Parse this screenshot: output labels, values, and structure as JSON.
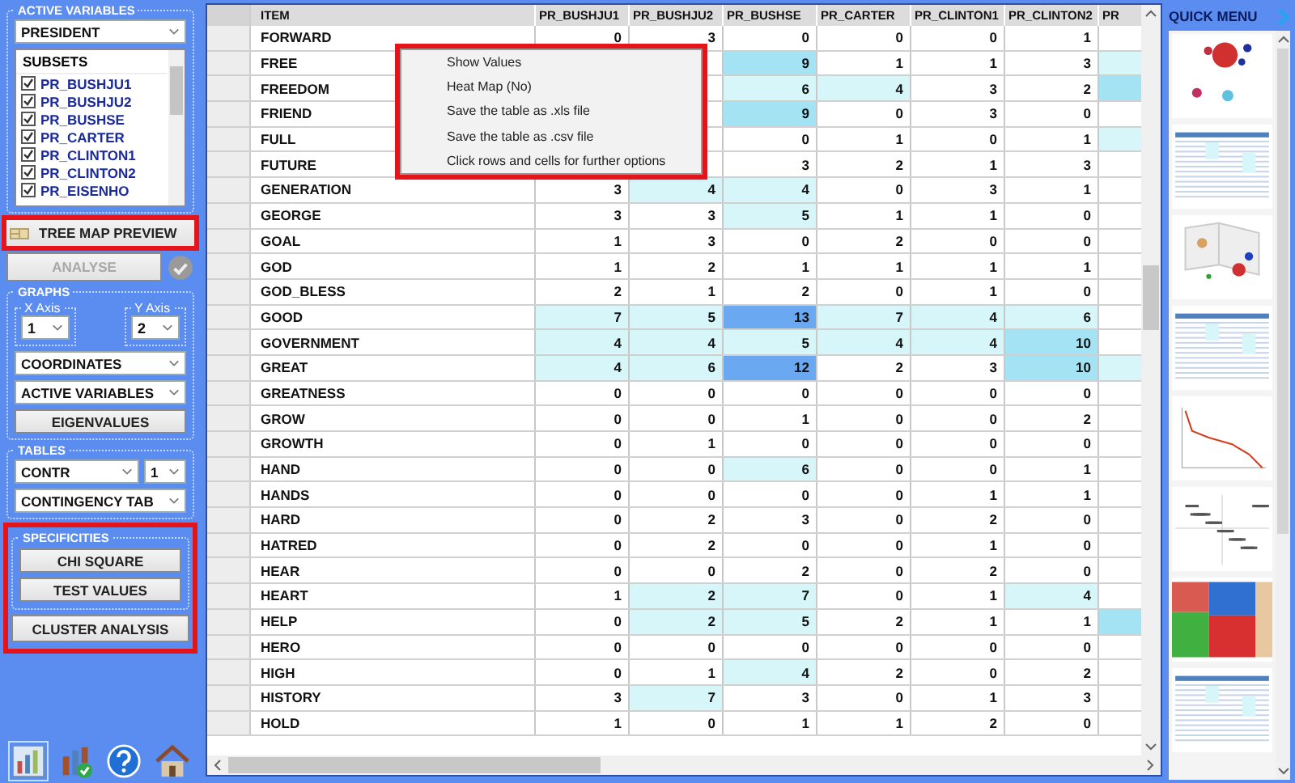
{
  "left_panel": {
    "active_variables": {
      "title": "ACTIVE VARIABLES",
      "dropdown": "PRESIDENT",
      "subsets_title": "SUBSETS",
      "subsets": [
        {
          "label": "PR_BUSHJU1",
          "checked": true
        },
        {
          "label": "PR_BUSHJU2",
          "checked": true
        },
        {
          "label": "PR_BUSHSE",
          "checked": true
        },
        {
          "label": "PR_CARTER",
          "checked": true
        },
        {
          "label": "PR_CLINTON1",
          "checked": true
        },
        {
          "label": "PR_CLINTON2",
          "checked": true
        },
        {
          "label": "PR_EISENHO",
          "checked": true
        }
      ]
    },
    "tree_map_button": {
      "label": "TREE MAP PREVIEW",
      "highlighted": true
    },
    "analyse_button": {
      "label": "ANALYSE",
      "disabled": true
    },
    "graphs": {
      "title": "GRAPHS",
      "x_axis": {
        "label": "X Axis",
        "value": "1"
      },
      "y_axis": {
        "label": "Y Axis",
        "value": "2"
      },
      "dropdowns": [
        "COORDINATES",
        "ACTIVE VARIABLES"
      ],
      "button": "EIGENVALUES"
    },
    "tables": {
      "title": "TABLES",
      "measure": "CONTR",
      "number": "1",
      "table_type": "CONTINGENCY TAB"
    },
    "specificities": {
      "title": "SPECIFICITIES",
      "highlighted": true,
      "buttons": [
        "CHI SQUARE",
        "TEST VALUES"
      ],
      "cluster_button": "CLUSTER ANALYSIS"
    }
  },
  "table": {
    "columns": [
      "ITEM",
      "PR_BUSHJU1",
      "PR_BUSHJU2",
      "PR_BUSHSE",
      "PR_CARTER",
      "PR_CLINTON1",
      "PR_CLINTON2",
      "PR"
    ],
    "rows": [
      {
        "cells": [
          {
            "value": "FORWARD"
          },
          {
            "value": "0"
          },
          {
            "value": "3"
          },
          {
            "value": "0"
          },
          {
            "value": "0"
          },
          {
            "value": "0"
          },
          {
            "value": "1"
          },
          {}
        ]
      },
      {
        "cells": [
          {
            "value": "FREE"
          },
          {},
          {},
          {
            "value": "9",
            "color": "#a3e3f3"
          },
          {
            "value": "1"
          },
          {
            "value": "1"
          },
          {
            "value": "3"
          },
          {
            "color": "#d6f6f9"
          }
        ]
      },
      {
        "cells": [
          {
            "value": "FREEDOM"
          },
          {},
          {},
          {
            "value": "6",
            "color": "#d6f6f9"
          },
          {
            "value": "4",
            "color": "#d6f6f9"
          },
          {
            "value": "3"
          },
          {
            "value": "2"
          },
          {
            "color": "#a3e3f3"
          }
        ]
      },
      {
        "cells": [
          {
            "value": "FRIEND"
          },
          {},
          {},
          {
            "value": "9",
            "color": "#a3e3f3"
          },
          {
            "value": "0"
          },
          {
            "value": "3"
          },
          {
            "value": "0"
          },
          {}
        ]
      },
      {
        "cells": [
          {
            "value": "FULL"
          },
          {},
          {},
          {
            "value": "0"
          },
          {
            "value": "1"
          },
          {
            "value": "0"
          },
          {
            "value": "1"
          },
          {
            "color": "#d6f6f9"
          }
        ]
      },
      {
        "cells": [
          {
            "value": "FUTURE"
          },
          {},
          {},
          {
            "value": "3"
          },
          {
            "value": "2"
          },
          {
            "value": "1"
          },
          {
            "value": "3"
          },
          {}
        ]
      },
      {
        "cells": [
          {
            "value": "GENERATION"
          },
          {
            "value": "3"
          },
          {
            "value": "4",
            "color": "#d6f6f9"
          },
          {
            "value": "4",
            "color": "#d6f6f9"
          },
          {
            "value": "0"
          },
          {
            "value": "3"
          },
          {
            "value": "1"
          },
          {}
        ]
      },
      {
        "cells": [
          {
            "value": "GEORGE"
          },
          {
            "value": "3"
          },
          {
            "value": "3"
          },
          {
            "value": "5",
            "color": "#d6f6f9"
          },
          {
            "value": "1"
          },
          {
            "value": "1"
          },
          {
            "value": "0"
          },
          {}
        ]
      },
      {
        "cells": [
          {
            "value": "GOAL"
          },
          {
            "value": "1"
          },
          {
            "value": "3"
          },
          {
            "value": "0"
          },
          {
            "value": "2"
          },
          {
            "value": "0"
          },
          {
            "value": "0"
          },
          {}
        ]
      },
      {
        "cells": [
          {
            "value": "GOD"
          },
          {
            "value": "1"
          },
          {
            "value": "2"
          },
          {
            "value": "1"
          },
          {
            "value": "1"
          },
          {
            "value": "1"
          },
          {
            "value": "1"
          },
          {}
        ]
      },
      {
        "cells": [
          {
            "value": "GOD_BLESS"
          },
          {
            "value": "2"
          },
          {
            "value": "1"
          },
          {
            "value": "2"
          },
          {
            "value": "0"
          },
          {
            "value": "1"
          },
          {
            "value": "0"
          },
          {}
        ]
      },
      {
        "cells": [
          {
            "value": "GOOD"
          },
          {
            "value": "7",
            "color": "#d6f6f9"
          },
          {
            "value": "5",
            "color": "#d6f6f9"
          },
          {
            "value": "13",
            "color": "#6aa8f2"
          },
          {
            "value": "7",
            "color": "#d6f6f9"
          },
          {
            "value": "4",
            "color": "#d6f6f9"
          },
          {
            "value": "6",
            "color": "#d6f6f9"
          },
          {}
        ]
      },
      {
        "cells": [
          {
            "value": "GOVERNMENT"
          },
          {
            "value": "4",
            "color": "#d6f6f9"
          },
          {
            "value": "4",
            "color": "#d6f6f9"
          },
          {
            "value": "5",
            "color": "#d6f6f9"
          },
          {
            "value": "4",
            "color": "#d6f6f9"
          },
          {
            "value": "4",
            "color": "#d6f6f9"
          },
          {
            "value": "10",
            "color": "#a3e3f3"
          },
          {}
        ]
      },
      {
        "cells": [
          {
            "value": "GREAT"
          },
          {
            "value": "4",
            "color": "#d6f6f9"
          },
          {
            "value": "6",
            "color": "#d6f6f9"
          },
          {
            "value": "12",
            "color": "#6aa8f2"
          },
          {
            "value": "2"
          },
          {
            "value": "3"
          },
          {
            "value": "10",
            "color": "#a3e3f3"
          },
          {
            "color": "#d6f6f9"
          }
        ]
      },
      {
        "cells": [
          {
            "value": "GREATNESS"
          },
          {
            "value": "0"
          },
          {
            "value": "0"
          },
          {
            "value": "0"
          },
          {
            "value": "0"
          },
          {
            "value": "0"
          },
          {
            "value": "0"
          },
          {}
        ]
      },
      {
        "cells": [
          {
            "value": "GROW"
          },
          {
            "value": "0"
          },
          {
            "value": "0"
          },
          {
            "value": "1"
          },
          {
            "value": "0"
          },
          {
            "value": "0"
          },
          {
            "value": "2"
          },
          {}
        ]
      },
      {
        "cells": [
          {
            "value": "GROWTH"
          },
          {
            "value": "0"
          },
          {
            "value": "1"
          },
          {
            "value": "0"
          },
          {
            "value": "0"
          },
          {
            "value": "0"
          },
          {
            "value": "0"
          },
          {}
        ]
      },
      {
        "cells": [
          {
            "value": "HAND"
          },
          {
            "value": "0"
          },
          {
            "value": "0"
          },
          {
            "value": "6",
            "color": "#d6f6f9"
          },
          {
            "value": "0"
          },
          {
            "value": "0"
          },
          {
            "value": "1"
          },
          {}
        ]
      },
      {
        "cells": [
          {
            "value": "HANDS"
          },
          {
            "value": "0"
          },
          {
            "value": "0"
          },
          {
            "value": "0"
          },
          {
            "value": "0"
          },
          {
            "value": "1"
          },
          {
            "value": "1"
          },
          {}
        ]
      },
      {
        "cells": [
          {
            "value": "HARD"
          },
          {
            "value": "0"
          },
          {
            "value": "2"
          },
          {
            "value": "3"
          },
          {
            "value": "0"
          },
          {
            "value": "2"
          },
          {
            "value": "0"
          },
          {}
        ]
      },
      {
        "cells": [
          {
            "value": "HATRED"
          },
          {
            "value": "0"
          },
          {
            "value": "2"
          },
          {
            "value": "0"
          },
          {
            "value": "0"
          },
          {
            "value": "1"
          },
          {
            "value": "0"
          },
          {}
        ]
      },
      {
        "cells": [
          {
            "value": "HEAR"
          },
          {
            "value": "0"
          },
          {
            "value": "0"
          },
          {
            "value": "2"
          },
          {
            "value": "0"
          },
          {
            "value": "2"
          },
          {
            "value": "0"
          },
          {}
        ]
      },
      {
        "cells": [
          {
            "value": "HEART"
          },
          {
            "value": "1"
          },
          {
            "value": "2",
            "color": "#d6f6f9"
          },
          {
            "value": "7",
            "color": "#d6f6f9"
          },
          {
            "value": "0"
          },
          {
            "value": "1"
          },
          {
            "value": "4",
            "color": "#d6f6f9"
          },
          {}
        ]
      },
      {
        "cells": [
          {
            "value": "HELP"
          },
          {
            "value": "0"
          },
          {
            "value": "2",
            "color": "#d6f6f9"
          },
          {
            "value": "5",
            "color": "#d6f6f9"
          },
          {
            "value": "2"
          },
          {
            "value": "1"
          },
          {
            "value": "1"
          },
          {
            "color": "#a3e3f3"
          }
        ]
      },
      {
        "cells": [
          {
            "value": "HERO"
          },
          {
            "value": "0"
          },
          {
            "value": "0"
          },
          {
            "value": "0"
          },
          {
            "value": "0"
          },
          {
            "value": "0"
          },
          {
            "value": "0"
          },
          {}
        ]
      },
      {
        "cells": [
          {
            "value": "HIGH"
          },
          {
            "value": "0"
          },
          {
            "value": "1"
          },
          {
            "value": "4",
            "color": "#d6f6f9"
          },
          {
            "value": "2"
          },
          {
            "value": "0"
          },
          {
            "value": "2"
          },
          {}
        ]
      },
      {
        "cells": [
          {
            "value": "HISTORY"
          },
          {
            "value": "3"
          },
          {
            "value": "7",
            "color": "#d6f6f9"
          },
          {
            "value": "3"
          },
          {
            "value": "0"
          },
          {
            "value": "1"
          },
          {
            "value": "3"
          },
          {}
        ]
      },
      {
        "cells": [
          {
            "value": "HOLD"
          },
          {
            "value": "1"
          },
          {
            "value": "0"
          },
          {
            "value": "1"
          },
          {
            "value": "1"
          },
          {
            "value": "2"
          },
          {
            "value": "0"
          },
          {}
        ]
      }
    ]
  },
  "context_menu": {
    "highlighted": true,
    "items": [
      "Show Values",
      "Heat Map (No)",
      "Save the table as .xls file",
      "Save the table as .csv file",
      "Click rows and cells for further options"
    ]
  },
  "quick_menu": {
    "title": "QUICK MENU"
  }
}
